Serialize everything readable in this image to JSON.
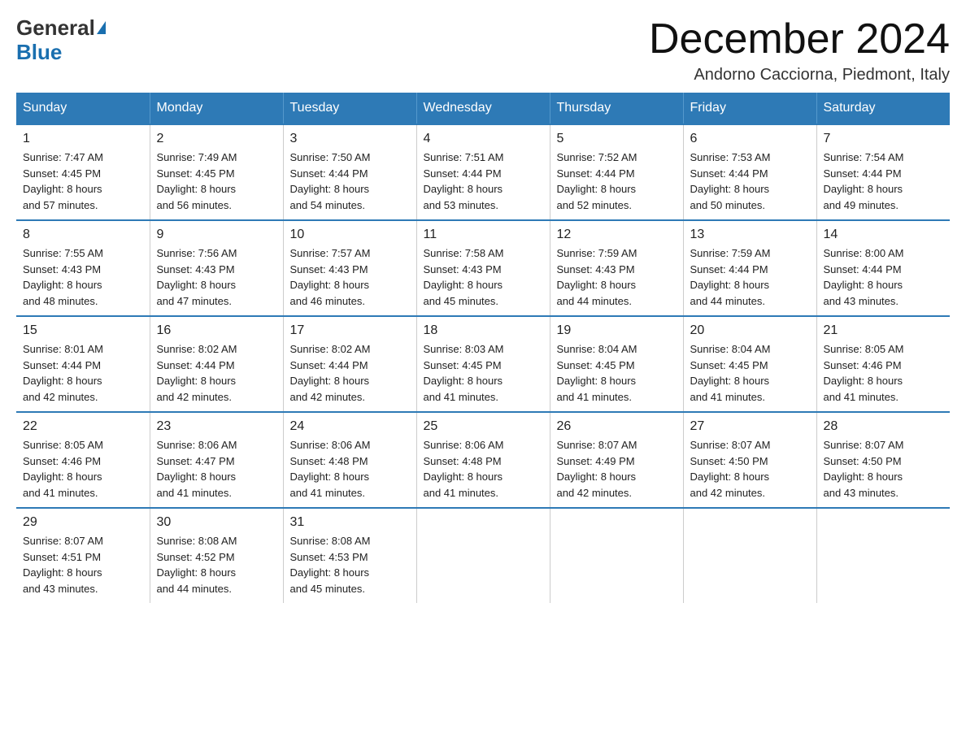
{
  "logo": {
    "general": "General",
    "triangle": "▲",
    "blue": "Blue"
  },
  "header": {
    "month": "December 2024",
    "location": "Andorno Cacciorna, Piedmont, Italy"
  },
  "days_header": [
    "Sunday",
    "Monday",
    "Tuesday",
    "Wednesday",
    "Thursday",
    "Friday",
    "Saturday"
  ],
  "weeks": [
    [
      {
        "day": "1",
        "info": "Sunrise: 7:47 AM\nSunset: 4:45 PM\nDaylight: 8 hours\nand 57 minutes."
      },
      {
        "day": "2",
        "info": "Sunrise: 7:49 AM\nSunset: 4:45 PM\nDaylight: 8 hours\nand 56 minutes."
      },
      {
        "day": "3",
        "info": "Sunrise: 7:50 AM\nSunset: 4:44 PM\nDaylight: 8 hours\nand 54 minutes."
      },
      {
        "day": "4",
        "info": "Sunrise: 7:51 AM\nSunset: 4:44 PM\nDaylight: 8 hours\nand 53 minutes."
      },
      {
        "day": "5",
        "info": "Sunrise: 7:52 AM\nSunset: 4:44 PM\nDaylight: 8 hours\nand 52 minutes."
      },
      {
        "day": "6",
        "info": "Sunrise: 7:53 AM\nSunset: 4:44 PM\nDaylight: 8 hours\nand 50 minutes."
      },
      {
        "day": "7",
        "info": "Sunrise: 7:54 AM\nSunset: 4:44 PM\nDaylight: 8 hours\nand 49 minutes."
      }
    ],
    [
      {
        "day": "8",
        "info": "Sunrise: 7:55 AM\nSunset: 4:43 PM\nDaylight: 8 hours\nand 48 minutes."
      },
      {
        "day": "9",
        "info": "Sunrise: 7:56 AM\nSunset: 4:43 PM\nDaylight: 8 hours\nand 47 minutes."
      },
      {
        "day": "10",
        "info": "Sunrise: 7:57 AM\nSunset: 4:43 PM\nDaylight: 8 hours\nand 46 minutes."
      },
      {
        "day": "11",
        "info": "Sunrise: 7:58 AM\nSunset: 4:43 PM\nDaylight: 8 hours\nand 45 minutes."
      },
      {
        "day": "12",
        "info": "Sunrise: 7:59 AM\nSunset: 4:43 PM\nDaylight: 8 hours\nand 44 minutes."
      },
      {
        "day": "13",
        "info": "Sunrise: 7:59 AM\nSunset: 4:44 PM\nDaylight: 8 hours\nand 44 minutes."
      },
      {
        "day": "14",
        "info": "Sunrise: 8:00 AM\nSunset: 4:44 PM\nDaylight: 8 hours\nand 43 minutes."
      }
    ],
    [
      {
        "day": "15",
        "info": "Sunrise: 8:01 AM\nSunset: 4:44 PM\nDaylight: 8 hours\nand 42 minutes."
      },
      {
        "day": "16",
        "info": "Sunrise: 8:02 AM\nSunset: 4:44 PM\nDaylight: 8 hours\nand 42 minutes."
      },
      {
        "day": "17",
        "info": "Sunrise: 8:02 AM\nSunset: 4:44 PM\nDaylight: 8 hours\nand 42 minutes."
      },
      {
        "day": "18",
        "info": "Sunrise: 8:03 AM\nSunset: 4:45 PM\nDaylight: 8 hours\nand 41 minutes."
      },
      {
        "day": "19",
        "info": "Sunrise: 8:04 AM\nSunset: 4:45 PM\nDaylight: 8 hours\nand 41 minutes."
      },
      {
        "day": "20",
        "info": "Sunrise: 8:04 AM\nSunset: 4:45 PM\nDaylight: 8 hours\nand 41 minutes."
      },
      {
        "day": "21",
        "info": "Sunrise: 8:05 AM\nSunset: 4:46 PM\nDaylight: 8 hours\nand 41 minutes."
      }
    ],
    [
      {
        "day": "22",
        "info": "Sunrise: 8:05 AM\nSunset: 4:46 PM\nDaylight: 8 hours\nand 41 minutes."
      },
      {
        "day": "23",
        "info": "Sunrise: 8:06 AM\nSunset: 4:47 PM\nDaylight: 8 hours\nand 41 minutes."
      },
      {
        "day": "24",
        "info": "Sunrise: 8:06 AM\nSunset: 4:48 PM\nDaylight: 8 hours\nand 41 minutes."
      },
      {
        "day": "25",
        "info": "Sunrise: 8:06 AM\nSunset: 4:48 PM\nDaylight: 8 hours\nand 41 minutes."
      },
      {
        "day": "26",
        "info": "Sunrise: 8:07 AM\nSunset: 4:49 PM\nDaylight: 8 hours\nand 42 minutes."
      },
      {
        "day": "27",
        "info": "Sunrise: 8:07 AM\nSunset: 4:50 PM\nDaylight: 8 hours\nand 42 minutes."
      },
      {
        "day": "28",
        "info": "Sunrise: 8:07 AM\nSunset: 4:50 PM\nDaylight: 8 hours\nand 43 minutes."
      }
    ],
    [
      {
        "day": "29",
        "info": "Sunrise: 8:07 AM\nSunset: 4:51 PM\nDaylight: 8 hours\nand 43 minutes."
      },
      {
        "day": "30",
        "info": "Sunrise: 8:08 AM\nSunset: 4:52 PM\nDaylight: 8 hours\nand 44 minutes."
      },
      {
        "day": "31",
        "info": "Sunrise: 8:08 AM\nSunset: 4:53 PM\nDaylight: 8 hours\nand 45 minutes."
      },
      {
        "day": "",
        "info": ""
      },
      {
        "day": "",
        "info": ""
      },
      {
        "day": "",
        "info": ""
      },
      {
        "day": "",
        "info": ""
      }
    ]
  ]
}
